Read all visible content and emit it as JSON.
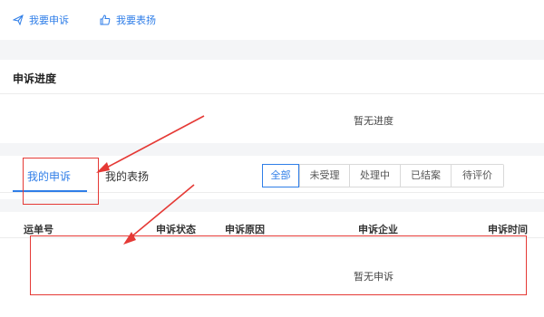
{
  "toplinks": {
    "complain": {
      "label": "我要申诉",
      "icon": "send-icon"
    },
    "praise": {
      "label": "我要表扬",
      "icon": "thumbs-up-icon"
    }
  },
  "progress": {
    "title": "申诉进度",
    "empty": "暂无进度"
  },
  "tabs": [
    {
      "label": "我的申诉",
      "active": true
    },
    {
      "label": "我的表扬",
      "active": false
    }
  ],
  "filters": [
    {
      "label": "全部",
      "active": true
    },
    {
      "label": "未受理",
      "active": false
    },
    {
      "label": "处理中",
      "active": false
    },
    {
      "label": "已结案",
      "active": false
    },
    {
      "label": "待评价",
      "active": false
    }
  ],
  "table": {
    "columns": [
      "运单号",
      "申诉状态",
      "申诉原因",
      "申诉企业",
      "申诉时间"
    ],
    "empty": "暂无申诉"
  },
  "colors": {
    "accent": "#2f7ee8",
    "annotation": "#e53935",
    "band": "#f4f5f7"
  }
}
